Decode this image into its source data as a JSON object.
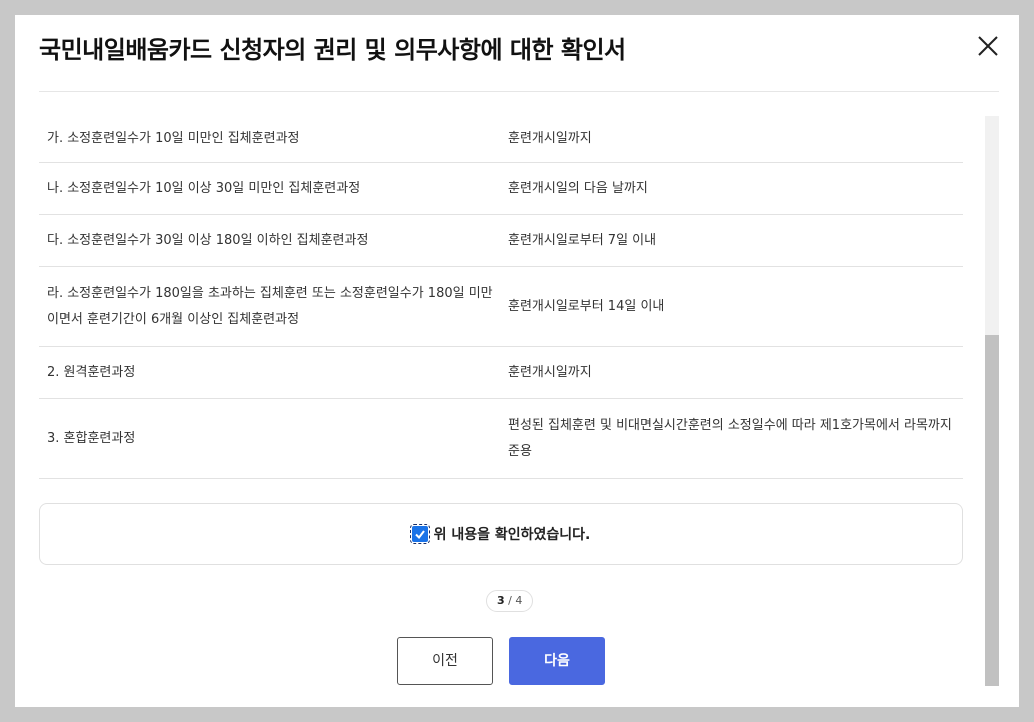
{
  "modal": {
    "title": "국민내일배움카드 신청자의 권리 및 의무사항에 대한 확인서"
  },
  "table": {
    "rows": [
      {
        "left": "가. 소정훈련일수가 10일 미만인 집체훈련과정",
        "right": "훈련개시일까지"
      },
      {
        "left": "나. 소정훈련일수가 10일 이상 30일 미만인 집체훈련과정",
        "right": "훈련개시일의 다음 날까지"
      },
      {
        "left": "다. 소정훈련일수가 30일 이상 180일 이하인 집체훈련과정",
        "right": "훈련개시일로부터 7일 이내"
      },
      {
        "left": "라. 소정훈련일수가 180일을 초과하는 집체훈련 또는 소정훈련일수가 180일 미만이면서 훈련기간이 6개월 이상인 집체훈련과정",
        "right": "훈련개시일로부터 14일 이내"
      },
      {
        "left": "2. 원격훈련과정",
        "right": "훈련개시일까지"
      },
      {
        "left": "3. 혼합훈련과정",
        "right": "편성된 집체훈련 및 비대면실시간훈련의 소정일수에 따라 제1호가목에서 라목까지 준용"
      }
    ]
  },
  "confirm": {
    "label": "위 내용을 확인하였습니다.",
    "checked": true
  },
  "pagination": {
    "current": "3",
    "total": "/ 4"
  },
  "buttons": {
    "prev_label": "이전",
    "next_label": "다음"
  },
  "colors": {
    "primary": "#4a68e0",
    "checkbox": "#1a73e8"
  }
}
